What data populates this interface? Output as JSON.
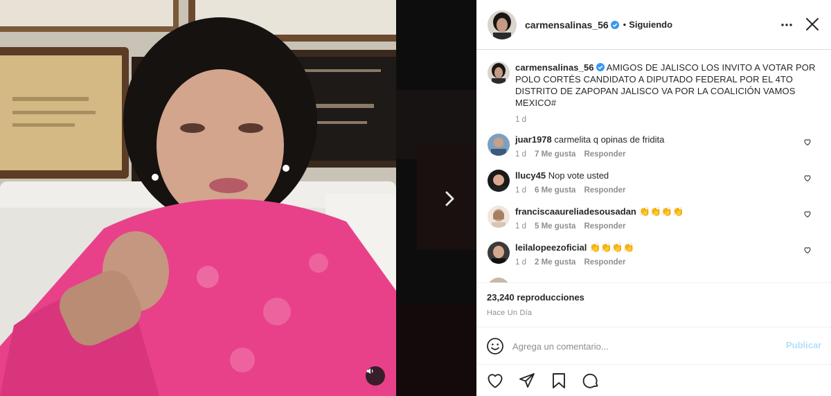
{
  "post": {
    "username": "carmensalinas_56",
    "separator": "•",
    "following_label": "Siguiendo",
    "caption": "AMIGOS DE JALISCO LOS INVITO A VOTAR POR POLO CORTÉS CANDIDATO A DIPUTADO FEDERAL POR EL 4TO DISTRITO DE ZAPOPAN JALISCO VA POR LA COALICIÓN VAMOS MEXICO#",
    "caption_time": "1 d",
    "views": "23,240 reproducciones",
    "posted_ago": "Hace Un Día"
  },
  "comments": [
    {
      "user": "juar1978",
      "text": "carmelita q opinas de fridita",
      "time": "1 d",
      "likes": "7 Me gusta",
      "reply": "Responder"
    },
    {
      "user": "llucy45",
      "text": "Nop vote usted",
      "time": "1 d",
      "likes": "6 Me gusta",
      "reply": "Responder"
    },
    {
      "user": "franciscaaureliadesousadan",
      "text": "👏👏👏👏",
      "time": "1 d",
      "likes": "5 Me gusta",
      "reply": "Responder"
    },
    {
      "user": "leilalopeezoficial",
      "text": "👏👏👏👏",
      "time": "1 d",
      "likes": "2 Me gusta",
      "reply": "Responder"
    }
  ],
  "add_comment": {
    "placeholder": "Agrega un comentario...",
    "publish_label": "Publicar"
  },
  "icons": {
    "more": "more-options-icon",
    "close": "close-icon",
    "verified": "verified-badge-icon",
    "heart": "heart-icon",
    "emoji": "emoji-icon",
    "like": "like-icon",
    "share": "share-icon",
    "save": "save-icon",
    "comment": "comment-icon",
    "next": "chevron-right-icon",
    "mute": "speaker-icon"
  },
  "colors": {
    "accent": "#0095f6",
    "publish_disabled": "#b2dffc",
    "verified": "#3897f0",
    "text_primary": "#262626",
    "text_secondary": "#8e8e8e"
  }
}
